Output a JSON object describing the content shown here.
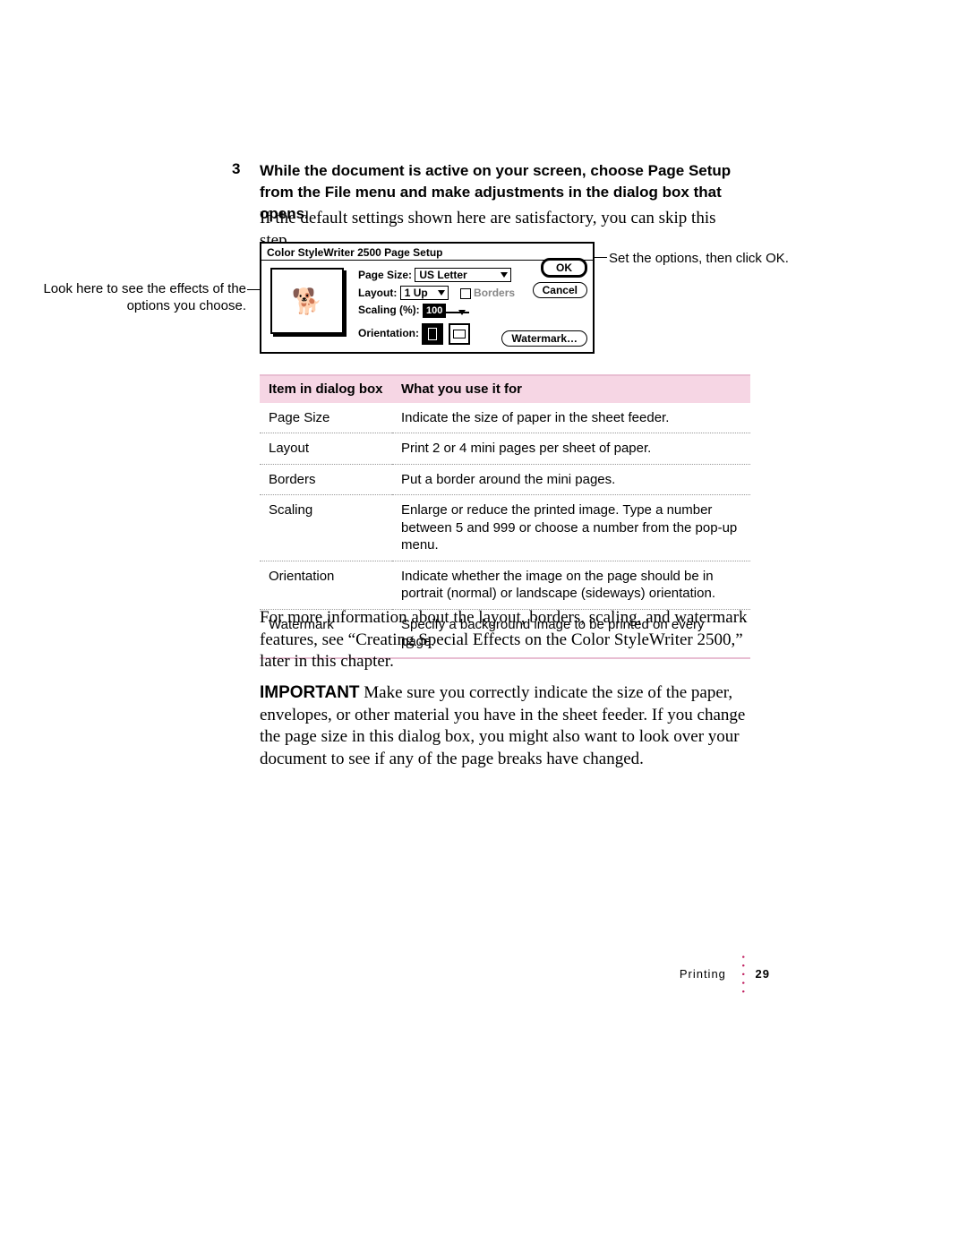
{
  "step_number": "3",
  "instruction": "While the document is active on your screen, choose Page Setup from the File menu and make adjustments in the dialog box that opens.",
  "intro_text": "If the default settings shown here are satisfactory, you can skip this step.",
  "callout_left": "Look here to see the effects of the options you choose.",
  "callout_right": "Set the options, then click OK.",
  "dialog": {
    "title": "Color StyleWriter 2500 Page Setup",
    "page_size_label": "Page Size:",
    "page_size_value": "US Letter",
    "layout_label": "Layout:",
    "layout_value": "1 Up",
    "borders_label": "Borders",
    "scaling_label": "Scaling (%):",
    "scaling_value": "100",
    "orientation_label": "Orientation:",
    "ok_label": "OK",
    "cancel_label": "Cancel",
    "watermark_label": "Watermark…"
  },
  "table": {
    "header_item": "Item in dialog box",
    "header_use": "What you use it for",
    "rows": [
      {
        "item": "Page Size",
        "use": "Indicate the size of paper in the sheet feeder."
      },
      {
        "item": "Layout",
        "use": "Print 2 or 4 mini pages per sheet of paper."
      },
      {
        "item": "Borders",
        "use": "Put a border around the mini pages."
      },
      {
        "item": "Scaling",
        "use": "Enlarge or reduce the printed image. Type a number between 5 and 999 or choose a number from the pop-up menu."
      },
      {
        "item": "Orientation",
        "use": "Indicate whether the image on the page should be in portrait (normal) or landscape (sideways) orientation."
      },
      {
        "item": "Watermark",
        "use": "Specify a background image to be printed on every page."
      }
    ]
  },
  "para_more_info": "For more information about the layout, borders, scaling, and watermark features, see “Creating Special Effects on the Color StyleWriter 2500,” later in this chapter.",
  "important_label": "IMPORTANT",
  "important_text": "  Make sure you correctly indicate the size of the paper, envelopes, or other material you have in the sheet feeder. If you change the page size in this dialog box, you might also want to look over your document to see if any of the page breaks have changed.",
  "footer_section": "Printing",
  "footer_page": "29"
}
